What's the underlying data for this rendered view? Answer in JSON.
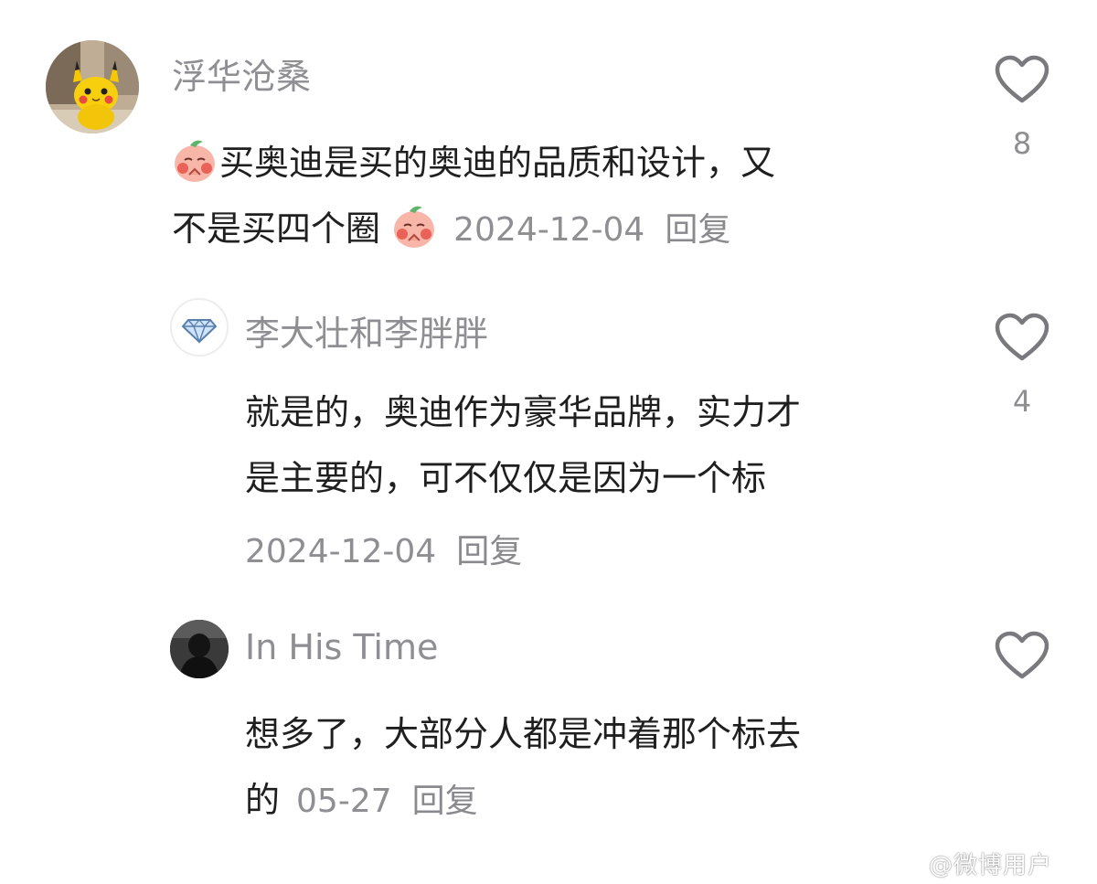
{
  "comments": [
    {
      "username": "浮华沧桑",
      "text_line1": "买奥迪是买的奥迪的品质和设计，又",
      "text_line2": "不是买四个圈",
      "date": "2024-12-04",
      "reply_label": "回复",
      "likes": "8",
      "avatar_icon": "pikachu-avatar",
      "emoji_icon": "peach-face-emoji"
    },
    {
      "username": "李大壮和李胖胖",
      "text_line1": "就是的，奥迪作为豪华品牌，实力才",
      "text_line2": "是主要的，可不仅仅是因为一个标",
      "date": "2024-12-04",
      "reply_label": "回复",
      "likes": "4",
      "avatar_icon": "diamond-icon"
    },
    {
      "username": "In His Time",
      "text_line1": "想多了，大部分人都是冲着那个标去",
      "text_line2": "的",
      "date": "05-27",
      "reply_label": "回复",
      "likes": "",
      "avatar_icon": "dark-photo-avatar"
    }
  ],
  "watermark": "@微博用户",
  "colors": {
    "username": "#8e8e93",
    "text": "#1f1f1f",
    "heart": "#7a7a7e"
  }
}
